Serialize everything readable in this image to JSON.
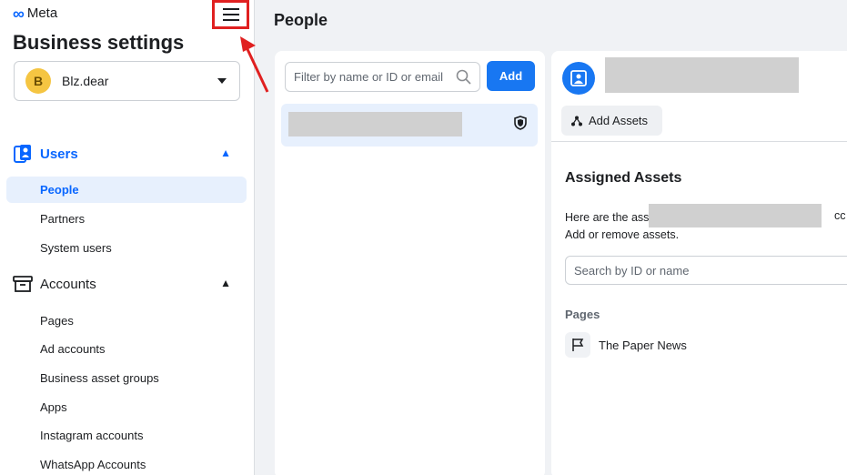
{
  "app": {
    "brand": "Meta",
    "title": "Business settings"
  },
  "business": {
    "initial": "B",
    "name": "Blz.dear"
  },
  "sidebar": {
    "sections": [
      {
        "label": "Users",
        "icon": "users-icon",
        "items": [
          "People",
          "Partners",
          "System users"
        ]
      },
      {
        "label": "Accounts",
        "icon": "accounts-icon",
        "items": [
          "Pages",
          "Ad accounts",
          "Business asset groups",
          "Apps",
          "Instagram accounts",
          "WhatsApp Accounts"
        ]
      }
    ]
  },
  "main": {
    "page_title": "People",
    "filter_placeholder": "Filter by name or ID or email",
    "add_label": "Add"
  },
  "detail": {
    "add_assets_label": "Add Assets",
    "assigned_title": "Assigned Assets",
    "desc_start": "Here are the asset",
    "desc_tail": "cc",
    "desc_line2": "Add or remove assets.",
    "search_placeholder": "Search by ID or name",
    "pages_label": "Pages",
    "page_name": "The Paper News"
  },
  "colors": {
    "accent": "#1877f2",
    "active_bg": "#e7f0fd",
    "annotation": "#e02020"
  }
}
